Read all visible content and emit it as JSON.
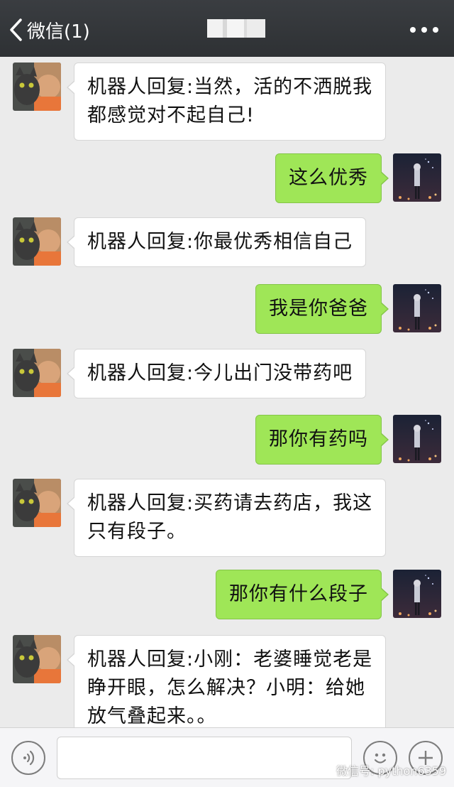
{
  "header": {
    "back_label": "微信(1)",
    "title": ""
  },
  "messages": [
    {
      "side": "left",
      "lines": [
        "机器人回复:当然，活的不洒脱我",
        "都感觉对不起自己!"
      ]
    },
    {
      "side": "right",
      "lines": [
        "这么优秀"
      ]
    },
    {
      "side": "left",
      "lines": [
        "机器人回复:你最优秀相信自己"
      ]
    },
    {
      "side": "right",
      "lines": [
        "我是你爸爸"
      ]
    },
    {
      "side": "left",
      "lines": [
        "机器人回复:今儿出门没带药吧"
      ]
    },
    {
      "side": "right",
      "lines": [
        "那你有药吗"
      ]
    },
    {
      "side": "left",
      "lines": [
        "机器人回复:买药请去药店，我这",
        "只有段子。"
      ]
    },
    {
      "side": "right",
      "lines": [
        "那你有什么段子"
      ]
    },
    {
      "side": "left",
      "lines": [
        "机器人回复:小刚：老婆睡觉老是",
        "睁开眼，怎么解决？小明：给她",
        "放气叠起来。。"
      ]
    }
  ],
  "input_bar": {
    "watermark": "微信号: python6359"
  },
  "colors": {
    "top_bar": "#2e3134",
    "chat_background": "#ebebeb",
    "my_bubble": "#9fe657",
    "bot_bubble": "#ffffff"
  },
  "icons": {
    "back": "chevron-left-icon",
    "more": "more-dots-icon",
    "voice": "voice-icon",
    "emoji": "emoji-icon",
    "plus": "plus-icon"
  }
}
